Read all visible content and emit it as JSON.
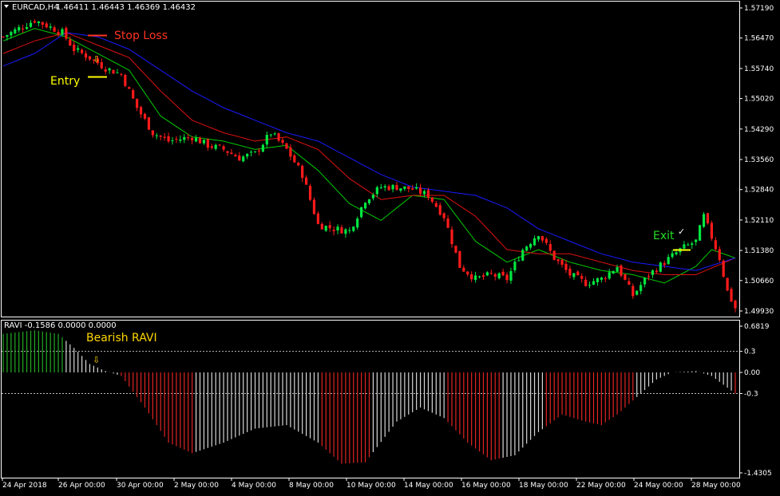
{
  "header": {
    "symbol_label": "EURCAD,H4",
    "ohlc_label": "1.46411 1.46443 1.46369 1.46432"
  },
  "subwindow": {
    "indicator_label": "RAVI -0.1586 0.0000 0.0000"
  },
  "annotations": {
    "stop_loss": "Stop Loss",
    "entry": "Entry",
    "exit": "Exit",
    "exit_mark": "✓",
    "bearish_ravi": "Bearish RAVI",
    "entry_arrow": "⇩",
    "ravi_arrow": "⇩"
  },
  "colors": {
    "bull_candle": "#00e640",
    "bear_candle": "#ff1a1a",
    "ma_fast": "#00cc00",
    "ma_mid": "#dd1111",
    "ma_slow": "#1a1aff",
    "ravi_bull": "#22aa22",
    "ravi_bear": "#e22222",
    "ravi_neutral": "#d8d8d8",
    "stop_loss": "#ff3322",
    "entry": "#ffff00",
    "exit": "#22dd22",
    "bearish_ravi": "#ffd700",
    "arrow": "#ffd700"
  },
  "chart_data": [
    {
      "type": "candlestick",
      "symbol": "EURCAD",
      "timeframe": "H4",
      "ylim": [
        1.4993,
        1.5719
      ],
      "y_ticks": [
        "1.57190",
        "1.56470",
        "1.55740",
        "1.55020",
        "1.54290",
        "1.53560",
        "1.52840",
        "1.52110",
        "1.51380",
        "1.50660",
        "1.49930"
      ],
      "x_ticks": [
        "24 Apr 2018",
        "26 Apr 00:00",
        "30 Apr 00:00",
        "2 May 00:00",
        "4 May 00:00",
        "8 May 00:00",
        "10 May 00:00",
        "14 May 00:00",
        "16 May 00:00",
        "18 May 00:00",
        "22 May 00:00",
        "24 May 00:00",
        "28 May 00:00"
      ],
      "close_anchors": [
        [
          0,
          1.565
        ],
        [
          8,
          1.569
        ],
        [
          15,
          1.566
        ],
        [
          18,
          1.562
        ],
        [
          22,
          1.56
        ],
        [
          26,
          1.5575
        ],
        [
          30,
          1.556
        ],
        [
          34,
          1.548
        ],
        [
          38,
          1.542
        ],
        [
          42,
          1.54
        ],
        [
          48,
          1.541
        ],
        [
          52,
          1.539
        ],
        [
          56,
          1.538
        ],
        [
          60,
          1.536
        ],
        [
          64,
          1.537
        ],
        [
          68,
          1.542
        ],
        [
          72,
          1.538
        ],
        [
          76,
          1.532
        ],
        [
          80,
          1.52
        ],
        [
          84,
          1.519
        ],
        [
          88,
          1.5185
        ],
        [
          92,
          1.526
        ],
        [
          96,
          1.529
        ],
        [
          100,
          1.529
        ],
        [
          104,
          1.5285
        ],
        [
          108,
          1.527
        ],
        [
          112,
          1.522
        ],
        [
          116,
          1.51
        ],
        [
          120,
          1.507
        ],
        [
          124,
          1.508
        ],
        [
          128,
          1.507
        ],
        [
          132,
          1.514
        ],
        [
          136,
          1.518
        ],
        [
          140,
          1.512
        ],
        [
          144,
          1.508
        ],
        [
          148,
          1.506
        ],
        [
          152,
          1.507
        ],
        [
          156,
          1.51
        ],
        [
          160,
          1.503
        ],
        [
          164,
          1.508
        ],
        [
          168,
          1.511
        ],
        [
          172,
          1.514
        ],
        [
          176,
          1.516
        ],
        [
          178,
          1.522
        ],
        [
          182,
          1.512
        ],
        [
          184,
          1.504
        ],
        [
          186,
          1.5
        ]
      ],
      "series": [
        {
          "name": "",
          "role": "ma_fast",
          "values": [
            [
              0,
              1.564
            ],
            [
              8,
              1.567
            ],
            [
              16,
              1.565
            ],
            [
              24,
              1.561
            ],
            [
              32,
              1.557
            ],
            [
              40,
              1.546
            ],
            [
              48,
              1.541
            ],
            [
              56,
              1.54
            ],
            [
              64,
              1.538
            ],
            [
              72,
              1.539
            ],
            [
              80,
              1.533
            ],
            [
              88,
              1.525
            ],
            [
              96,
              1.521
            ],
            [
              104,
              1.527
            ],
            [
              112,
              1.526
            ],
            [
              120,
              1.516
            ],
            [
              128,
              1.511
            ],
            [
              136,
              1.514
            ],
            [
              144,
              1.511
            ],
            [
              152,
              1.509
            ],
            [
              160,
              1.508
            ],
            [
              168,
              1.506
            ],
            [
              176,
              1.51
            ],
            [
              180,
              1.514
            ],
            [
              186,
              1.512
            ]
          ]
        },
        {
          "name": "",
          "role": "ma_mid",
          "values": [
            [
              0,
              1.561
            ],
            [
              8,
              1.564
            ],
            [
              16,
              1.566
            ],
            [
              24,
              1.563
            ],
            [
              32,
              1.56
            ],
            [
              40,
              1.552
            ],
            [
              48,
              1.545
            ],
            [
              56,
              1.542
            ],
            [
              64,
              1.54
            ],
            [
              72,
              1.541
            ],
            [
              80,
              1.538
            ],
            [
              88,
              1.531
            ],
            [
              96,
              1.526
            ],
            [
              104,
              1.527
            ],
            [
              112,
              1.527
            ],
            [
              120,
              1.522
            ],
            [
              128,
              1.514
            ],
            [
              136,
              1.513
            ],
            [
              144,
              1.513
            ],
            [
              152,
              1.511
            ],
            [
              160,
              1.509
            ],
            [
              168,
              1.508
            ],
            [
              176,
              1.508
            ],
            [
              186,
              1.512
            ]
          ]
        },
        {
          "name": "",
          "role": "ma_slow",
          "values": [
            [
              0,
              1.558
            ],
            [
              8,
              1.561
            ],
            [
              16,
              1.566
            ],
            [
              24,
              1.565
            ],
            [
              32,
              1.562
            ],
            [
              40,
              1.557
            ],
            [
              48,
              1.552
            ],
            [
              56,
              1.548
            ],
            [
              64,
              1.545
            ],
            [
              72,
              1.542
            ],
            [
              80,
              1.54
            ],
            [
              88,
              1.536
            ],
            [
              96,
              1.532
            ],
            [
              104,
              1.529
            ],
            [
              112,
              1.528
            ],
            [
              120,
              1.527
            ],
            [
              128,
              1.524
            ],
            [
              136,
              1.519
            ],
            [
              144,
              1.516
            ],
            [
              152,
              1.513
            ],
            [
              160,
              1.511
            ],
            [
              168,
              1.51
            ],
            [
              176,
              1.509
            ],
            [
              186,
              1.512
            ]
          ]
        }
      ],
      "annotations": [
        {
          "label": "Stop Loss",
          "price": 1.5665,
          "bar": 27
        },
        {
          "label": "Entry",
          "price": 1.557,
          "bar": 27
        },
        {
          "label": "Exit",
          "price": 1.513,
          "bar": 170
        }
      ]
    },
    {
      "type": "histogram",
      "indicator": "RAVI",
      "ylim": [
        -1.4305,
        0.6819
      ],
      "y_ticks": [
        "0.6819",
        "0.3",
        "0.00",
        "-0.3",
        "-1.4305"
      ],
      "levels": [
        0.3,
        -0.3
      ],
      "anchors": [
        [
          0,
          0.55
        ],
        [
          8,
          0.6
        ],
        [
          14,
          0.55
        ],
        [
          18,
          0.35
        ],
        [
          22,
          0.12
        ],
        [
          26,
          0.02
        ],
        [
          30,
          -0.05
        ],
        [
          36,
          -0.5
        ],
        [
          42,
          -1.0
        ],
        [
          48,
          -1.15
        ],
        [
          56,
          -1.0
        ],
        [
          64,
          -0.8
        ],
        [
          72,
          -0.75
        ],
        [
          80,
          -1.0
        ],
        [
          86,
          -1.3
        ],
        [
          92,
          -1.28
        ],
        [
          100,
          -0.7
        ],
        [
          106,
          -0.5
        ],
        [
          112,
          -0.65
        ],
        [
          118,
          -1.0
        ],
        [
          124,
          -1.25
        ],
        [
          130,
          -1.18
        ],
        [
          136,
          -0.85
        ],
        [
          142,
          -0.6
        ],
        [
          148,
          -0.7
        ],
        [
          152,
          -0.75
        ],
        [
          156,
          -0.6
        ],
        [
          162,
          -0.3
        ],
        [
          166,
          -0.1
        ],
        [
          170,
          0.0
        ],
        [
          176,
          0.02
        ],
        [
          180,
          -0.05
        ],
        [
          186,
          -0.3
        ]
      ],
      "segments": [
        {
          "from": 0,
          "to": 15,
          "color": "bull"
        },
        {
          "from": 16,
          "to": 29,
          "color": "neutral"
        },
        {
          "from": 30,
          "to": 48,
          "color": "bear"
        },
        {
          "from": 49,
          "to": 80,
          "color": "neutral"
        },
        {
          "from": 81,
          "to": 93,
          "color": "bear"
        },
        {
          "from": 94,
          "to": 112,
          "color": "neutral"
        },
        {
          "from": 113,
          "to": 126,
          "color": "bear"
        },
        {
          "from": 127,
          "to": 137,
          "color": "neutral"
        },
        {
          "from": 138,
          "to": 160,
          "color": "bear"
        },
        {
          "from": 161,
          "to": 185,
          "color": "neutral"
        },
        {
          "from": 186,
          "to": 186,
          "color": "bear"
        }
      ],
      "bars": 187
    }
  ]
}
